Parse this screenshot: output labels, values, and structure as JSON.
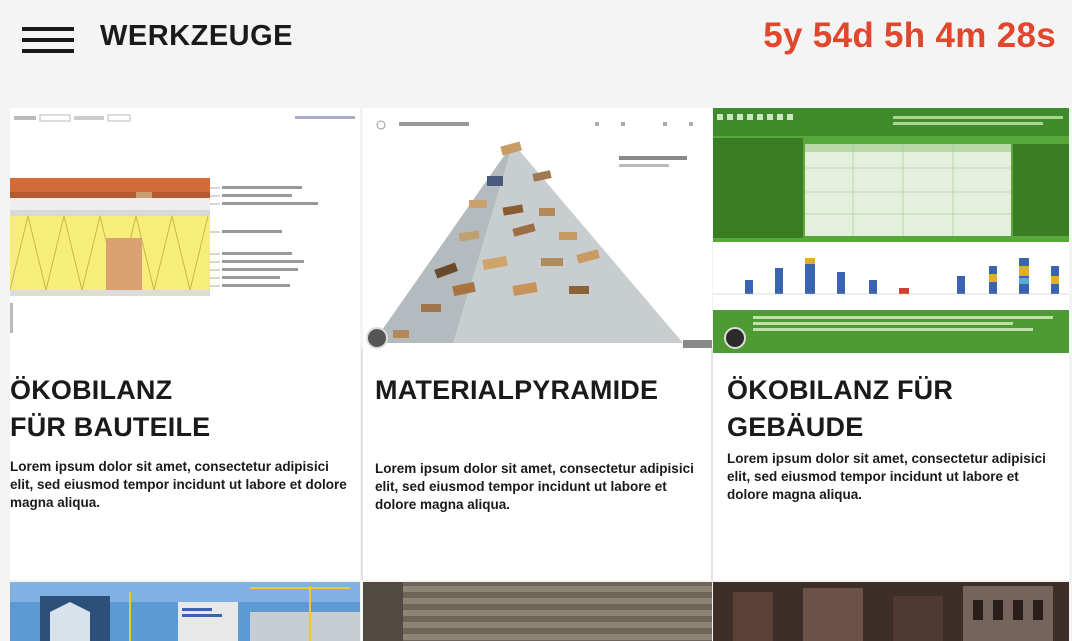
{
  "header": {
    "title": "WERKZEUGE",
    "countdown": "5y 54d 5h 4m 28s"
  },
  "cards": [
    {
      "title_lines": [
        "ÖKOBILANZ",
        "FÜR BAUTEILE"
      ],
      "text": "Lorem ipsum dolor sit amet, consectetur adipisici elit, sed eiusmod tempor incidunt ut labore et dolore magna aliqua."
    },
    {
      "title_lines": [
        "MATERIALPYRAMIDE"
      ],
      "text": "Lorem ipsum dolor sit amet, consectetur adipisici elit, sed eiusmod tempor incidunt ut labore et dolore magna aliqua."
    },
    {
      "title_lines": [
        "ÖKOBILANZ FÜR",
        "GEBÄUDE"
      ],
      "text": "Lorem ipsum dolor sit amet, consectetur adipisici elit, sed eiusmod tempor incidunt ut labore et dolore magna aliqua."
    }
  ],
  "colors": {
    "countdown": "#e0472c",
    "brand_text": "#1a1a1a",
    "background": "#f4f4f4"
  },
  "icons": [
    "menu-icon"
  ]
}
